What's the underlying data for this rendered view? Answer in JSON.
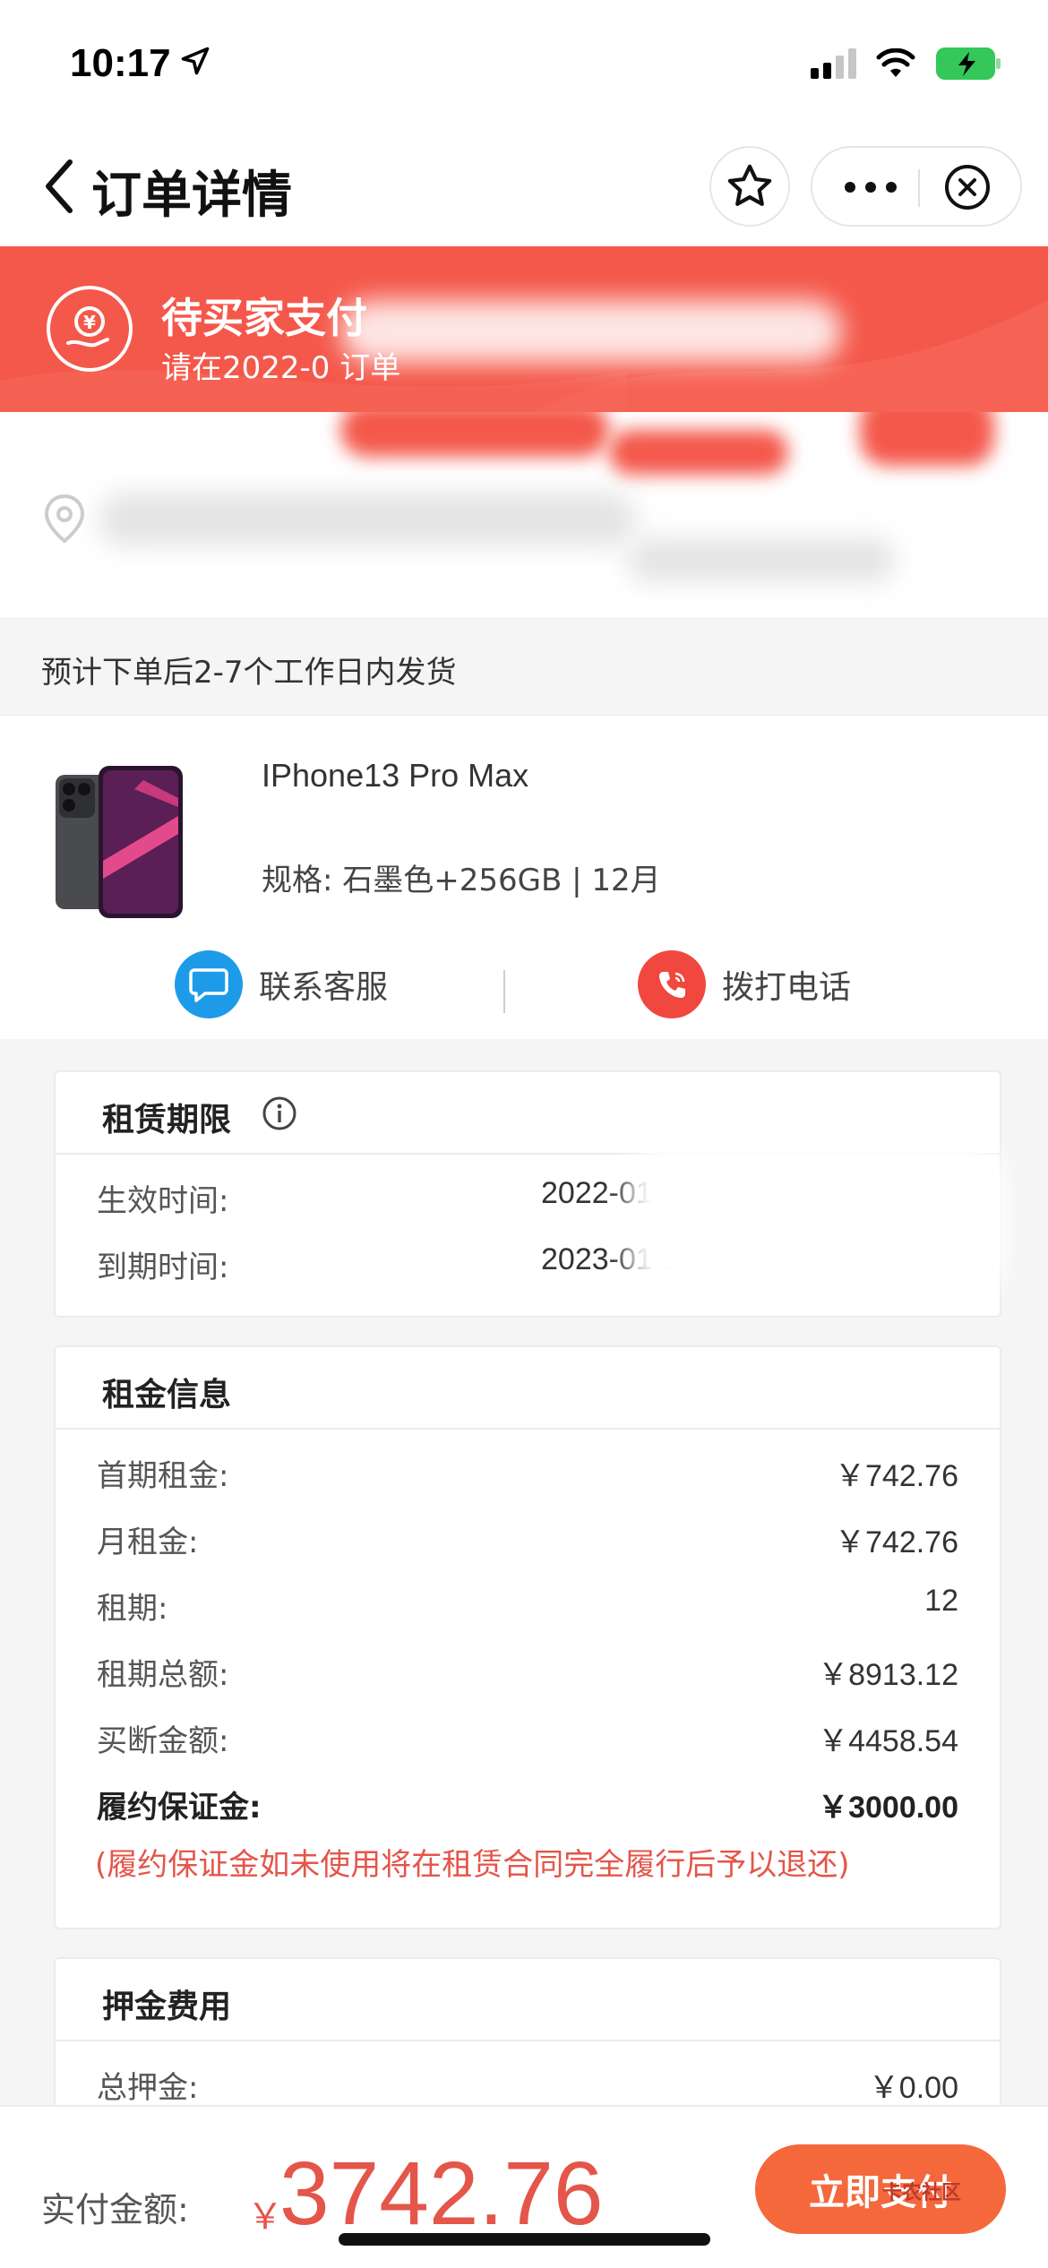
{
  "status_bar": {
    "time": "10:17",
    "icons": [
      "location-arrow-icon",
      "signal-icon",
      "wifi-icon",
      "battery-charging-icon"
    ],
    "battery_color": "#34c759"
  },
  "nav": {
    "title": "订单详情",
    "icons": [
      "back-arrow-icon",
      "star-icon",
      "more-icon",
      "close-icon"
    ]
  },
  "banner": {
    "title": "待买家支付",
    "subtitle": "请在2022-0 订单",
    "icon": "yen-hand-icon",
    "color": "#f4584a"
  },
  "shipping_note": "预计下单后2-7个工作日内发货",
  "product": {
    "name": "IPhone13 Pro Max",
    "spec": "规格: 石墨色+256GB | 12月",
    "contact_service": "联系客服",
    "call_phone": "拨打电话"
  },
  "lease_period": {
    "title": "租赁期限",
    "rows": [
      {
        "label": "生效时间:",
        "value": "2022-01-2"
      },
      {
        "label": "到期时间:",
        "value": "2023-01-24"
      }
    ]
  },
  "rent_info": {
    "title": "租金信息",
    "rows": [
      {
        "label": "首期租金:",
        "value": "￥742.76"
      },
      {
        "label": "月租金:",
        "value": "￥742.76"
      },
      {
        "label": "租期:",
        "value": "12"
      },
      {
        "label": "租期总额:",
        "value": "￥8913.12"
      },
      {
        "label": "买断金额:",
        "value": "￥4458.54"
      },
      {
        "label": "履约保证金:",
        "value": "￥3000.00"
      }
    ],
    "note": "(履约保证金如未使用将在租赁合同完全履行后予以退还)"
  },
  "deposit": {
    "title": "押金费用",
    "rows": [
      {
        "label": "总押金:",
        "value": "￥0.00"
      }
    ]
  },
  "footer": {
    "pay_label": "实付金额:",
    "currency": "￥",
    "amount": "3742.76",
    "pay_button": "立即支付",
    "watermark": "卡农社区"
  }
}
